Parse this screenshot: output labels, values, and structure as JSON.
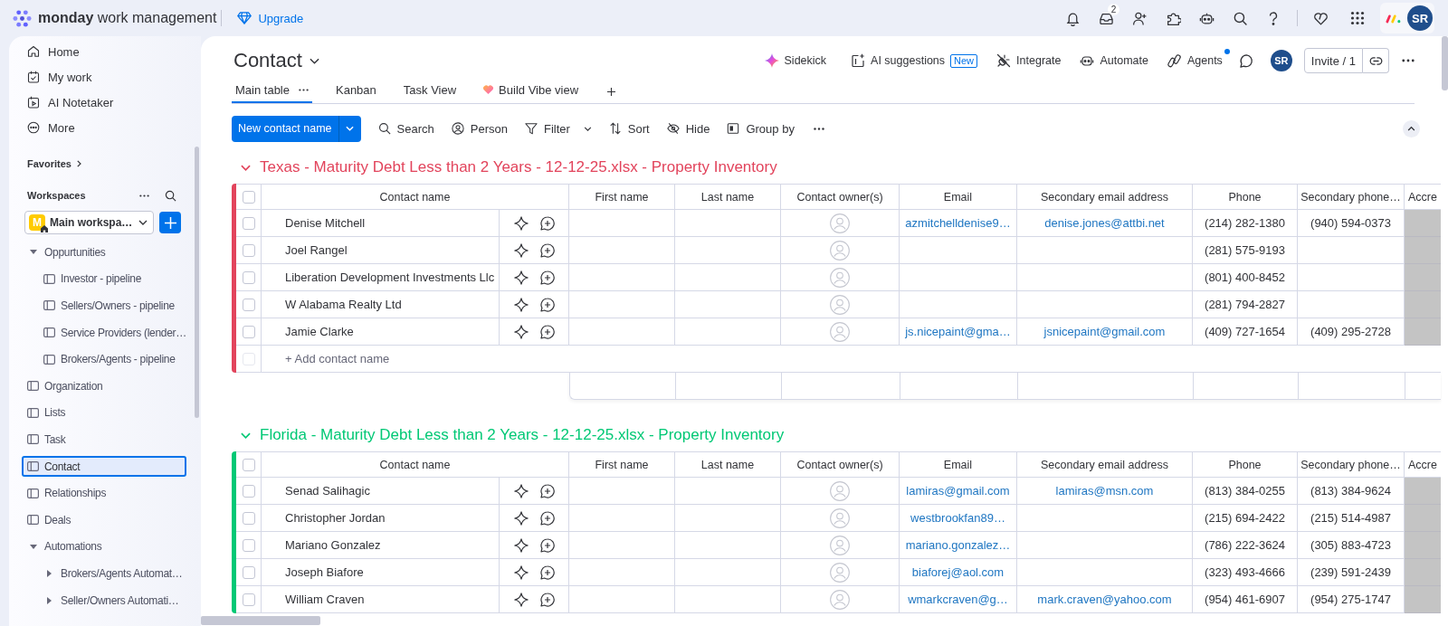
{
  "topbar": {
    "brand": "monday",
    "product": "work management",
    "upgrade": "Upgrade",
    "inbox_count": "2",
    "avatar": "SR"
  },
  "sidebar": {
    "nav": [
      {
        "label": "Home"
      },
      {
        "label": "My work"
      },
      {
        "label": "AI Notetaker"
      },
      {
        "label": "More"
      }
    ],
    "favorites": "Favorites",
    "workspaces": "Workspaces",
    "workspace": {
      "initial": "M",
      "name": "Main workspa…"
    },
    "tree": [
      {
        "kind": "folder",
        "label": "Oppurtunities",
        "expanded": true,
        "children": [
          {
            "kind": "board",
            "label": "Investor - pipeline",
            "editing": false
          },
          {
            "kind": "board",
            "label": "Sellers/Owners - pipeline",
            "editing": false
          },
          {
            "kind": "board",
            "label": "Service Providers (lender…",
            "editing": false
          },
          {
            "kind": "board",
            "label": "Brokers/Agents - pipeline",
            "editing": false
          }
        ]
      },
      {
        "kind": "board",
        "label": "Organization",
        "editing": false
      },
      {
        "kind": "board",
        "label": "Lists",
        "editing": false
      },
      {
        "kind": "board",
        "label": "Task",
        "editing": false
      },
      {
        "kind": "board",
        "label": "Contact",
        "editing": true
      },
      {
        "kind": "board",
        "label": "Relationships",
        "editing": false
      },
      {
        "kind": "board",
        "label": "Deals",
        "editing": false
      },
      {
        "kind": "folder",
        "label": "Automations",
        "expanded": true,
        "children": [
          {
            "kind": "folder",
            "label": "Brokers/Agents Automat…",
            "expanded": false
          },
          {
            "kind": "folder",
            "label": "Seller/Owners Automati…",
            "expanded": false
          }
        ]
      }
    ]
  },
  "board": {
    "title": "Contact",
    "actions": [
      {
        "label": "Sidekick",
        "notification": false
      },
      {
        "label": "AI suggestions",
        "badge": "New",
        "notification": false
      },
      {
        "label": "Integrate",
        "notification": false
      },
      {
        "label": "Automate",
        "notification": false
      },
      {
        "label": "Agents",
        "notification": true
      }
    ],
    "avatar": "SR",
    "invite": "Invite / 1",
    "views": [
      {
        "kind": "plain",
        "label": "Main table",
        "selected": true
      },
      {
        "kind": "plain",
        "label": "Kanban",
        "selected": false
      },
      {
        "kind": "plain",
        "label": "Task View",
        "selected": false
      },
      {
        "kind": "vibe",
        "label": "Build Vibe view",
        "selected": false
      }
    ]
  },
  "toolbar": {
    "primary": "New contact name",
    "tools": [
      {
        "label": "Search",
        "has_menu": false
      },
      {
        "label": "Person",
        "has_menu": false
      },
      {
        "label": "Filter",
        "has_menu": true
      },
      {
        "label": "Sort",
        "has_menu": false
      },
      {
        "label": "Hide",
        "has_menu": false
      },
      {
        "label": "Group by",
        "has_menu": false
      }
    ]
  },
  "groups": [
    {
      "title": "Texas - Maturity Debt Less than 2 Years - 12-12-25.xlsx - Property Inventory",
      "color": "#e2445c",
      "expanded": true,
      "all_checked": false,
      "columns": [
        "Contact name",
        "First name",
        "Last name",
        "Contact owner(s)",
        "Email",
        "Secondary email address",
        "Phone",
        "Secondary phone…",
        "Accre"
      ],
      "rows": [
        {
          "name": "Denise Mitchell",
          "checked": false,
          "email": "azmitchelldenise9…",
          "secondary_email": "denise.jones@attbi.net",
          "phone": "(214) 282-1380",
          "secondary_phone": "(940) 594-0373"
        },
        {
          "name": "Joel Rangel",
          "checked": false,
          "phone": "(281) 575-9193"
        },
        {
          "name": "Liberation Development Investments Llc",
          "checked": false,
          "phone": "(801) 400-8452"
        },
        {
          "name": "W Alabama Realty Ltd",
          "checked": false,
          "phone": "(281) 794-2827"
        },
        {
          "name": "Jamie Clarke",
          "checked": false,
          "email": "js.nicepaint@gma…",
          "secondary_email": "jsnicepaint@gmail.com",
          "phone": "(409) 727-1654",
          "secondary_phone": "(409) 295-2728"
        }
      ],
      "add_row": {
        "placeholder": "+ Add contact name",
        "checkbox_disabled": true
      }
    },
    {
      "title": "Florida - Maturity Debt Less than 2 Years - 12-12-25.xlsx - Property Inventory",
      "color": "#00c875",
      "expanded": true,
      "all_checked": false,
      "columns": [
        "Contact name",
        "First name",
        "Last name",
        "Contact owner(s)",
        "Email",
        "Secondary email address",
        "Phone",
        "Secondary phone…",
        "Accre"
      ],
      "rows": [
        {
          "name": "Senad Salihagic",
          "checked": false,
          "email": "lamiras@gmail.com",
          "secondary_email": "lamiras@msn.com",
          "phone": "(813) 384-0255",
          "secondary_phone": "(813) 384-9624"
        },
        {
          "name": "Christopher Jordan",
          "checked": false,
          "email": "westbrookfan89…",
          "phone": "(215) 694-2422",
          "secondary_phone": "(215) 514-4987"
        },
        {
          "name": "Mariano Gonzalez",
          "checked": false,
          "email": "mariano.gonzalez…",
          "phone": "(786) 222-3624",
          "secondary_phone": "(305) 883-4723"
        },
        {
          "name": "Joseph Biafore",
          "checked": false,
          "email": "biaforej@aol.com",
          "phone": "(323) 493-4666",
          "secondary_phone": "(239) 591-2439"
        },
        {
          "name": "William Craven",
          "checked": false,
          "email": "wmarkcraven@g…",
          "secondary_email": "mark.craven@yahoo.com",
          "phone": "(954) 461-6907",
          "secondary_phone": "(954) 275-1747"
        }
      ]
    }
  ]
}
